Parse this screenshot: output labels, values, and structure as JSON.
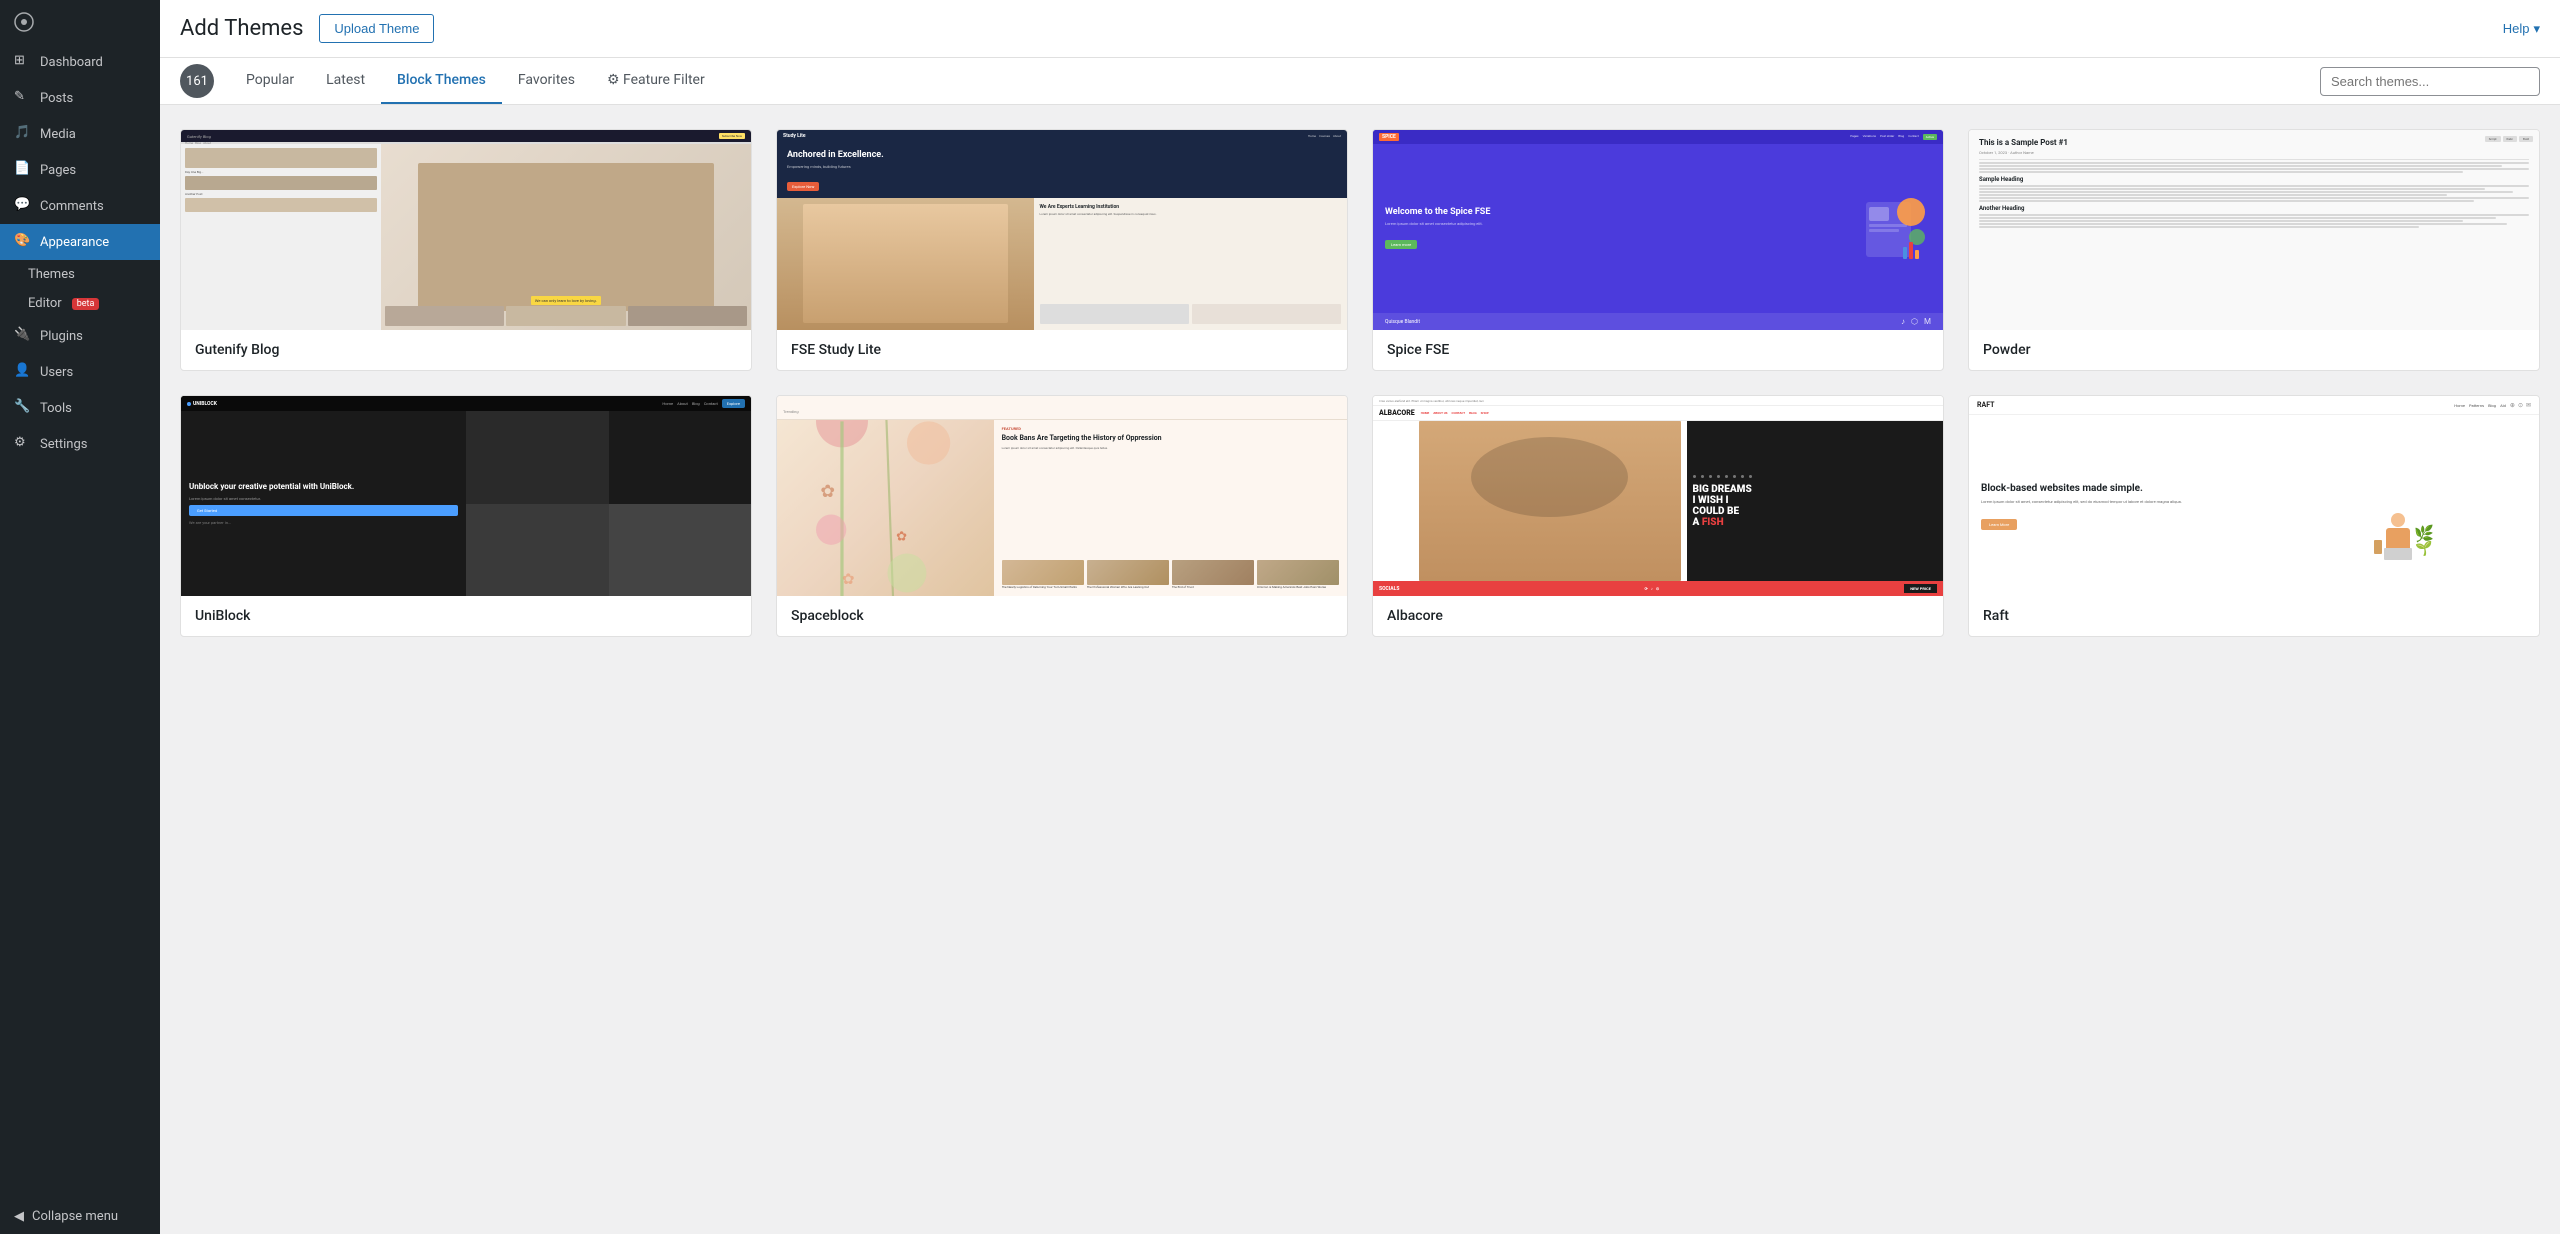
{
  "meta": {
    "help_label": "Help",
    "help_arrow": "▾"
  },
  "sidebar": {
    "logo_icon": "wordpress-icon",
    "items": [
      {
        "id": "dashboard",
        "label": "Dashboard",
        "icon": "dashboard-icon"
      },
      {
        "id": "posts",
        "label": "Posts",
        "icon": "posts-icon"
      },
      {
        "id": "media",
        "label": "Media",
        "icon": "media-icon"
      },
      {
        "id": "pages",
        "label": "Pages",
        "icon": "pages-icon"
      },
      {
        "id": "comments",
        "label": "Comments",
        "icon": "comments-icon"
      },
      {
        "id": "appearance",
        "label": "Appearance",
        "icon": "appearance-icon",
        "active": true,
        "subitems": [
          {
            "id": "themes",
            "label": "Themes",
            "active": false
          },
          {
            "id": "editor",
            "label": "Editor",
            "badge": "beta",
            "active": false
          }
        ]
      },
      {
        "id": "plugins",
        "label": "Plugins",
        "icon": "plugins-icon"
      },
      {
        "id": "users",
        "label": "Users",
        "icon": "users-icon"
      },
      {
        "id": "tools",
        "label": "Tools",
        "icon": "tools-icon"
      },
      {
        "id": "settings",
        "label": "Settings",
        "icon": "settings-icon"
      }
    ],
    "collapse_label": "Collapse menu"
  },
  "topbar": {
    "page_title": "Add Themes",
    "upload_btn_label": "Upload Theme",
    "help_label": "Help"
  },
  "tabs_bar": {
    "count": "161",
    "tabs": [
      {
        "id": "popular",
        "label": "Popular",
        "active": false
      },
      {
        "id": "latest",
        "label": "Latest",
        "active": false
      },
      {
        "id": "block-themes",
        "label": "Block Themes",
        "active": true
      },
      {
        "id": "favorites",
        "label": "Favorites",
        "active": false
      },
      {
        "id": "feature-filter",
        "label": "Feature Filter",
        "icon": "gear-icon",
        "active": false
      }
    ],
    "search_placeholder": "Search themes..."
  },
  "themes": [
    {
      "id": "gutenify-blog",
      "name": "Gutenify Blog",
      "preview_type": "gutenify"
    },
    {
      "id": "fse-study-lite",
      "name": "FSE Study Lite",
      "preview_type": "study-lite",
      "subtext": "Are Experts Learning Institution"
    },
    {
      "id": "spice-fse",
      "name": "Spice FSE",
      "preview_type": "spice",
      "subtext": "Welcome to the Spice FSE"
    },
    {
      "id": "powder",
      "name": "Powder",
      "preview_type": "powder"
    },
    {
      "id": "uniblock",
      "name": "UniBlock",
      "preview_type": "uniblock",
      "subtext": "Unblock your creative potential with UniBlock."
    },
    {
      "id": "spaceblock",
      "name": "Spaceblock",
      "preview_type": "spaceblock",
      "subtext": "Book Bans Are Targeting the History of Oppression"
    },
    {
      "id": "albacore",
      "name": "Albacore",
      "preview_type": "albacore",
      "subtext": "I WISH I COULD BE A FISH"
    },
    {
      "id": "raft",
      "name": "Raft",
      "preview_type": "raft",
      "subtext": "Block-based websites made simple."
    }
  ]
}
